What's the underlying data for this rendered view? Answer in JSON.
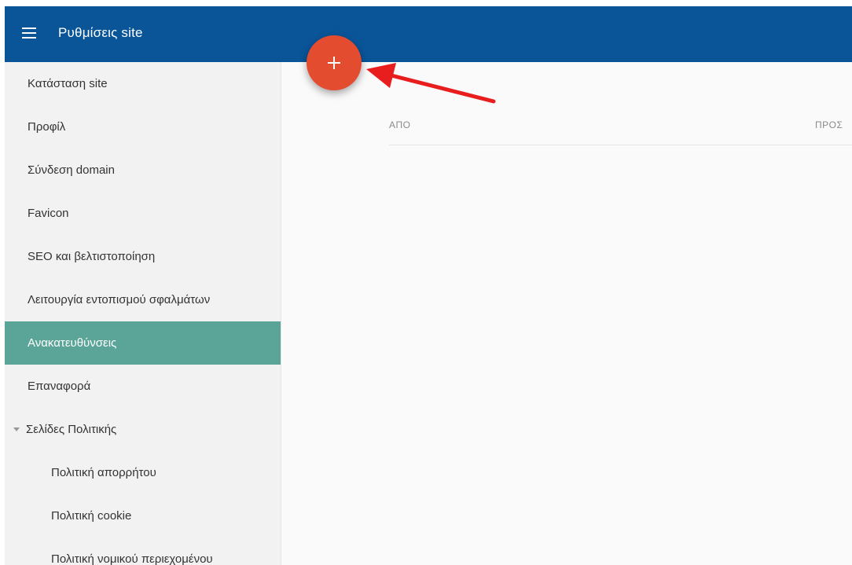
{
  "header": {
    "title": "Ρυθμίσεις site"
  },
  "sidebar": {
    "items": [
      {
        "label": "Κατάσταση site"
      },
      {
        "label": "Προφίλ"
      },
      {
        "label": "Σύνδεση domain"
      },
      {
        "label": "Favicon"
      },
      {
        "label": "SEO και βελτιστοποίηση"
      },
      {
        "label": "Λειτουργία εντοπισμού σφαλμάτων"
      },
      {
        "label": "Ανακατευθύνσεις",
        "active": true
      },
      {
        "label": "Επαναφορά"
      },
      {
        "label": "Σελίδες Πολιτικής",
        "expanded": true
      },
      {
        "label": "Πολιτική απορρήτου"
      },
      {
        "label": "Πολιτική cookie"
      },
      {
        "label": "Πολιτική νομικού περιεχομένου"
      }
    ]
  },
  "redirects": {
    "columns": {
      "from": "ΑΠΟ",
      "to": "ΠΡΟΣ"
    }
  },
  "fab": {
    "icon": "plus-icon"
  },
  "colors": {
    "topbar": "#0a5498",
    "active_item": "#5ba598",
    "fab": "#e44c30",
    "annotation_arrow": "#e81e1e"
  }
}
